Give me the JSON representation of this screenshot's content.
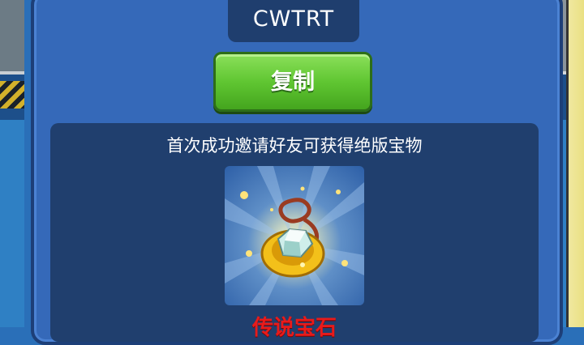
{
  "invite": {
    "code": "CWTRT",
    "copy_label": "复制",
    "reward_text": "首次成功邀请好友可获得绝版宝物",
    "reward_item_name": "传说宝石",
    "reward_item_icon": "gem-pendant-icon"
  }
}
